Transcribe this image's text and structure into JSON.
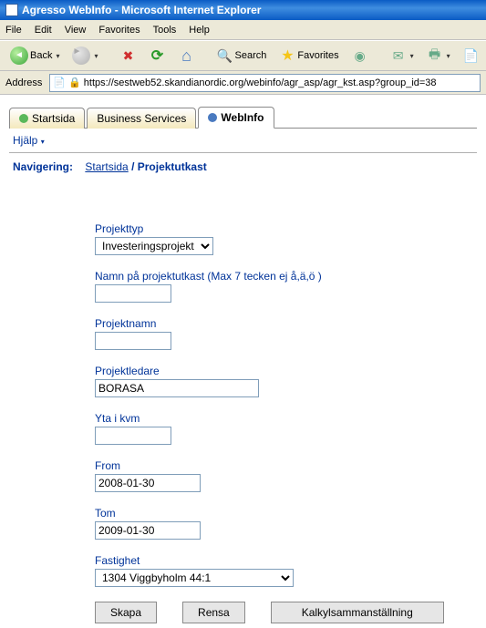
{
  "window": {
    "title": "Agresso WebInfo - Microsoft Internet Explorer"
  },
  "menubar": {
    "file": "File",
    "edit": "Edit",
    "view": "View",
    "favorites": "Favorites",
    "tools": "Tools",
    "help": "Help"
  },
  "toolbar": {
    "back": "Back",
    "search": "Search",
    "favorites": "Favorites"
  },
  "addressbar": {
    "label": "Address",
    "url": "https://sestweb52.skandianordic.org/webinfo/agr_asp/agr_kst.asp?group_id=38"
  },
  "tabs": {
    "startsida": "Startsida",
    "business_services": "Business Services",
    "webinfo": "WebInfo"
  },
  "sub": {
    "help": "Hjälp"
  },
  "breadcrumb": {
    "label": "Navigering:",
    "link": "Startsida",
    "leaf": "Projektutkast"
  },
  "form": {
    "projekttyp_label": "Projekttyp",
    "projekttyp_value": "Investeringsprojekt",
    "namn_label": "Namn på projektutkast (Max 7 tecken ej å,ä,ö )",
    "namn_value": "",
    "projektnamn_label": "Projektnamn",
    "projektnamn_value": "",
    "projektledare_label": "Projektledare",
    "projektledare_value": "BORASA",
    "yta_label": "Yta i kvm",
    "yta_value": "",
    "from_label": "From",
    "from_value": "2008-01-30",
    "tom_label": "Tom",
    "tom_value": "2009-01-30",
    "fastighet_label": "Fastighet",
    "fastighet_value": "1304 Viggbyholm 44:1"
  },
  "buttons": {
    "skapa": "Skapa",
    "rensa": "Rensa",
    "kalkyl": "Kalkylsammanställning"
  }
}
